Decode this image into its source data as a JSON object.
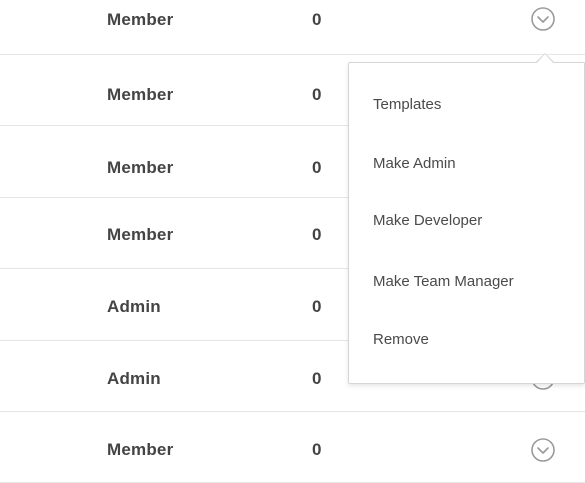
{
  "rows": [
    {
      "role": "Member",
      "count": "0"
    },
    {
      "role": "Member",
      "count": "0"
    },
    {
      "role": "Member",
      "count": "0"
    },
    {
      "role": "Member",
      "count": "0"
    },
    {
      "role": "Admin",
      "count": "0"
    },
    {
      "role": "Admin",
      "count": "0"
    },
    {
      "role": "Member",
      "count": "0"
    }
  ],
  "dropdown": {
    "items": [
      "Templates",
      "Make Admin",
      "Make Developer",
      "Make Team Manager",
      "Remove"
    ]
  },
  "icons": {
    "row_menu": "chevron-down-circle-icon"
  },
  "colors": {
    "text": "#444444",
    "divider": "#e6e6e6",
    "icon": "#9a9a9a",
    "menu_border": "#d6d6d6"
  }
}
